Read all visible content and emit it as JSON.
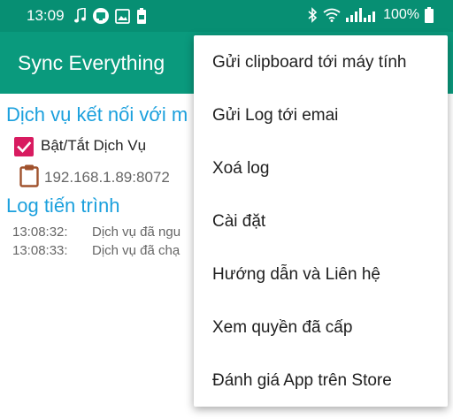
{
  "status_bar": {
    "time": "13:09",
    "battery": "100%"
  },
  "app_bar": {
    "title": "Sync Everything"
  },
  "main": {
    "service_heading": "Dịch vụ kết nối với m",
    "toggle_label": "Bật/Tắt Dịch Vụ",
    "ip_address": "192.168.1.89:8072",
    "log_heading": "Log tiến trình",
    "log_entries": [
      {
        "time": "13:08:32:",
        "message": "Dịch vụ đã ngu"
      },
      {
        "time": "13:08:33:",
        "message": "Dịch vụ đã chạ"
      }
    ]
  },
  "menu": {
    "items": [
      {
        "label": "Gửi clipboard tới máy tính"
      },
      {
        "label": "Gửi Log tới emai"
      },
      {
        "label": "Xoá log"
      },
      {
        "label": "Cài đặt"
      },
      {
        "label": "Hướng dẫn và Liên hệ"
      },
      {
        "label": "Xem quyền đã cấp"
      },
      {
        "label": "Đánh giá App trên Store"
      }
    ]
  },
  "colors": {
    "status_bar": "#078f73",
    "app_bar": "#0a9a7d",
    "heading": "#1ba0dd",
    "checkbox": "#d81b60",
    "clipboard_icon": "#a0522d"
  },
  "icons": [
    "music-note-icon",
    "sync-app-icon",
    "image-icon",
    "battery-saver-icon",
    "bluetooth-icon",
    "wifi-icon",
    "signal-icon",
    "battery-icon",
    "check-icon",
    "clipboard-icon"
  ]
}
